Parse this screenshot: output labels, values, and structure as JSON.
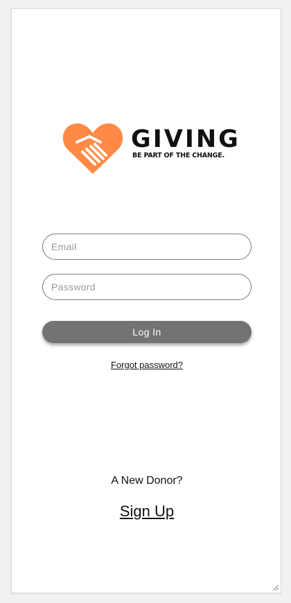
{
  "logo": {
    "brand_name": "GIVING",
    "tagline": "BE PART OF THE CHANGE.",
    "icon": "heart-handshake-icon",
    "accent_color": "#ff8a47"
  },
  "login_form": {
    "email_placeholder": "Email",
    "email_value": "",
    "password_placeholder": "Password",
    "password_value": "",
    "login_label": "Log In",
    "forgot_password_label": "Forgot password?"
  },
  "signup": {
    "prompt": "A New Donor?",
    "link_label": "Sign Up"
  },
  "colors": {
    "button_bg": "#737373",
    "field_border": "#7a7a7a",
    "page_bg": "#f1f1f3"
  }
}
